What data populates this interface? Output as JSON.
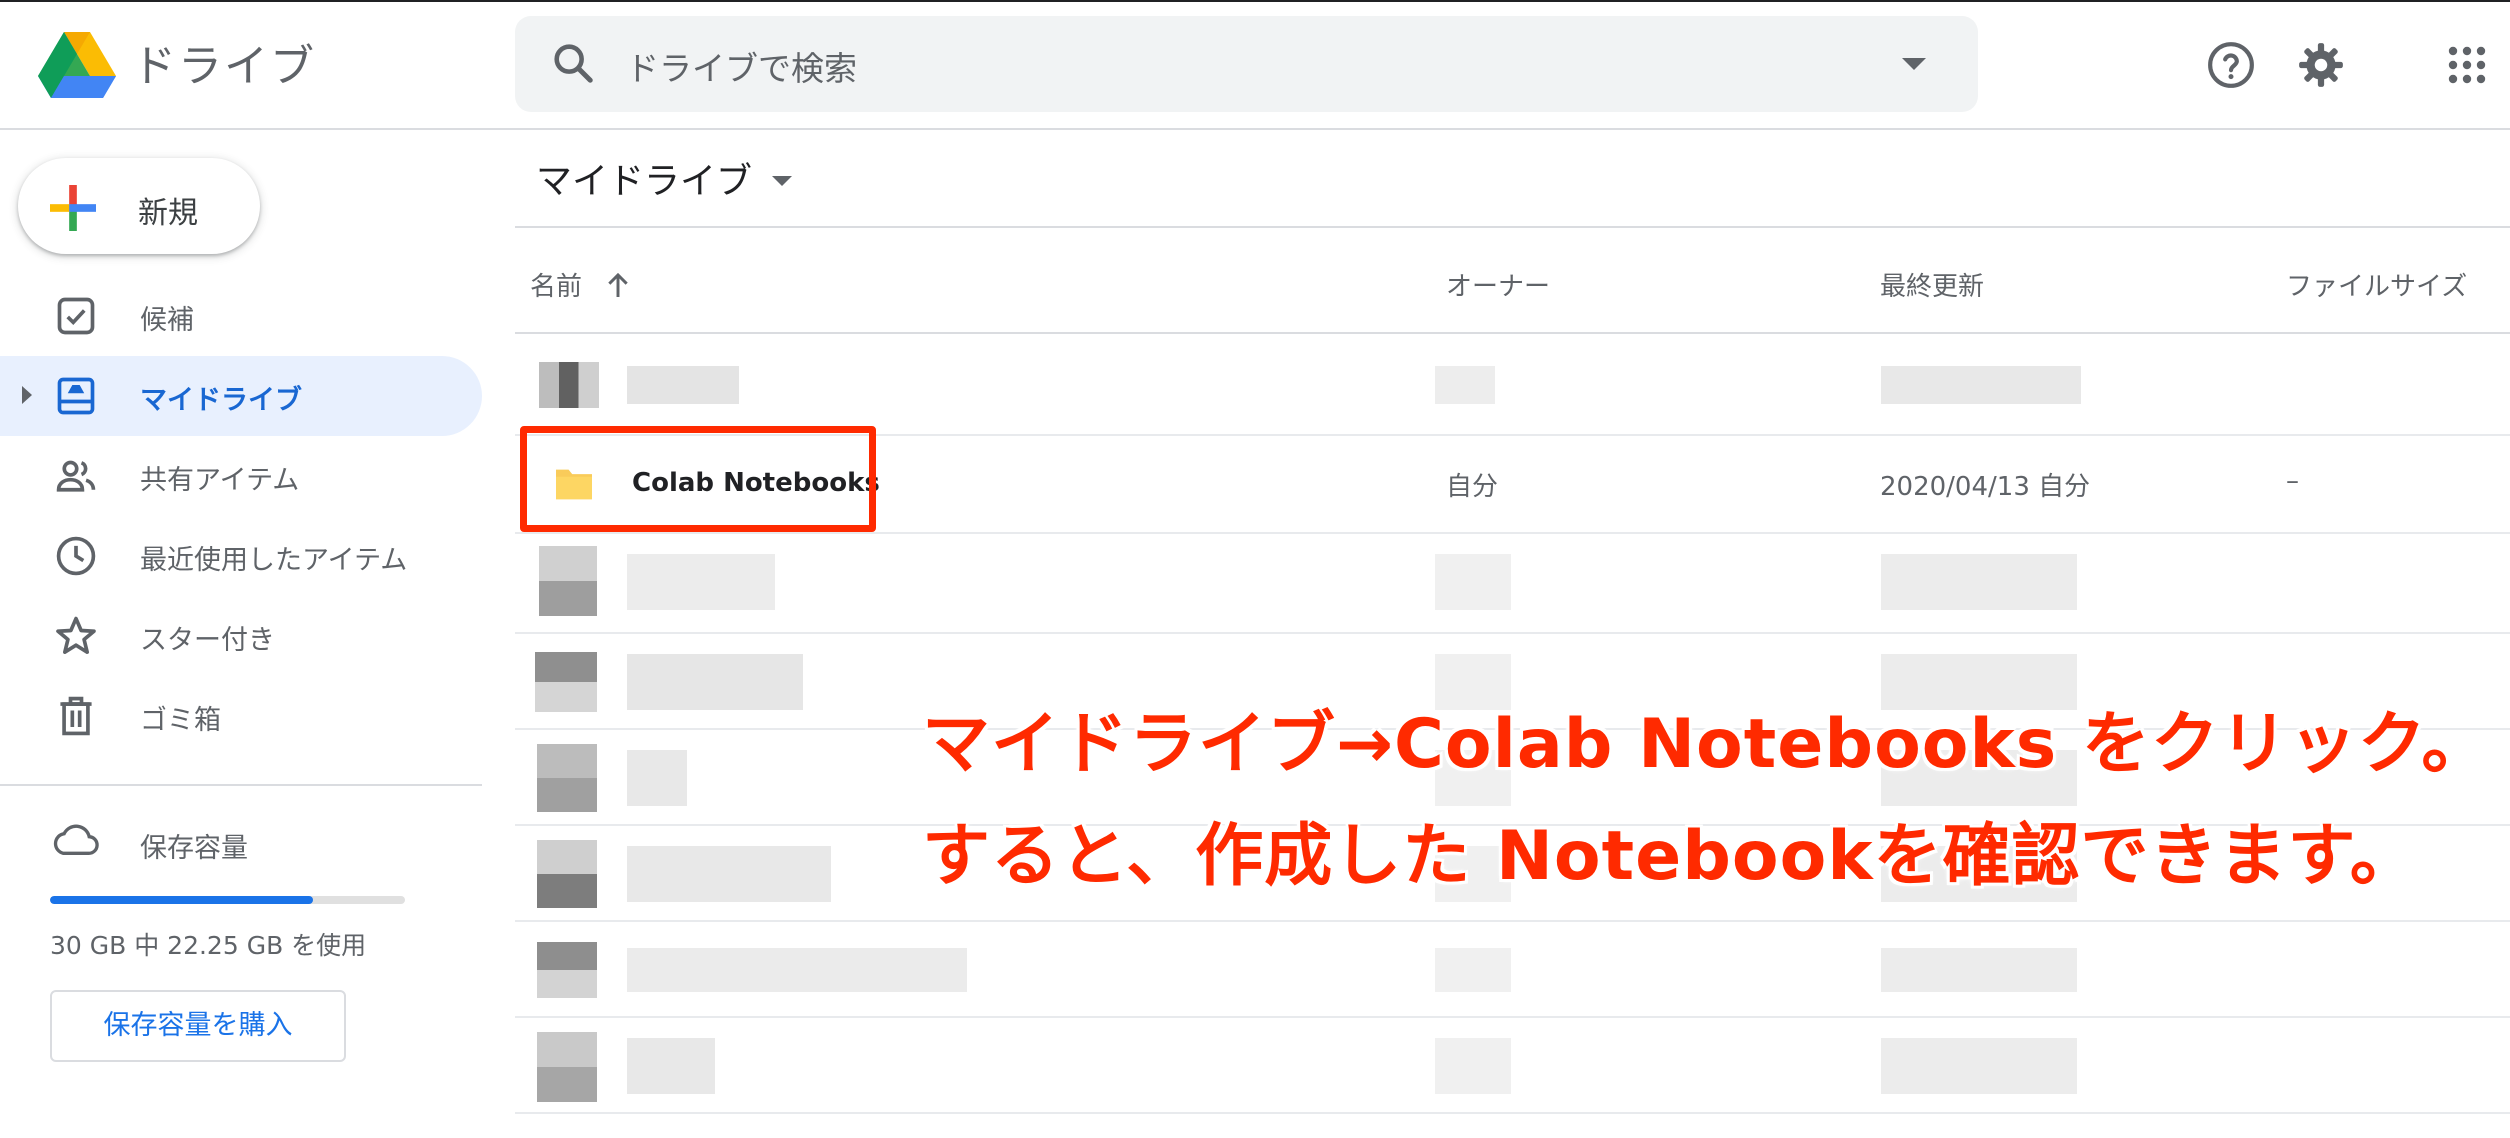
{
  "header": {
    "app_name": "ドライブ",
    "search": {
      "placeholder": "ドライブで検索"
    }
  },
  "sidebar": {
    "new_label": "新規",
    "items": [
      {
        "label": "候補",
        "icon": "check-box-icon"
      },
      {
        "label": "マイドライブ",
        "icon": "my-drive-icon",
        "active": true
      },
      {
        "label": "共有アイテム",
        "icon": "shared-people-icon"
      },
      {
        "label": "最近使用したアイテム",
        "icon": "clock-icon"
      },
      {
        "label": "スター付き",
        "icon": "star-icon"
      },
      {
        "label": "ゴミ箱",
        "icon": "trash-icon"
      }
    ],
    "storage": {
      "label": "保存容量",
      "usage_text": "30 GB 中 22.25 GB を使用",
      "used_gb": 22.25,
      "total_gb": 30,
      "buy_label": "保存容量を購入"
    }
  },
  "main": {
    "breadcrumb": "マイドライブ",
    "columns": [
      "名前",
      "オーナー",
      "最終更新",
      "ファイルサイズ"
    ],
    "folder": {
      "name": "Colab Notebooks",
      "owner": "自分",
      "modified": "2020/04/13 自分",
      "size": "–"
    }
  },
  "annotation": {
    "line1": "マイドライブ→Colab Notebooks をクリック。",
    "line2": "すると、作成した Notebookを確認できます。"
  },
  "colors": {
    "accent": "#1a73e8",
    "highlight": "#ff2a00",
    "active_bg": "#e8f0fe",
    "folder": "#f9cb5a"
  }
}
